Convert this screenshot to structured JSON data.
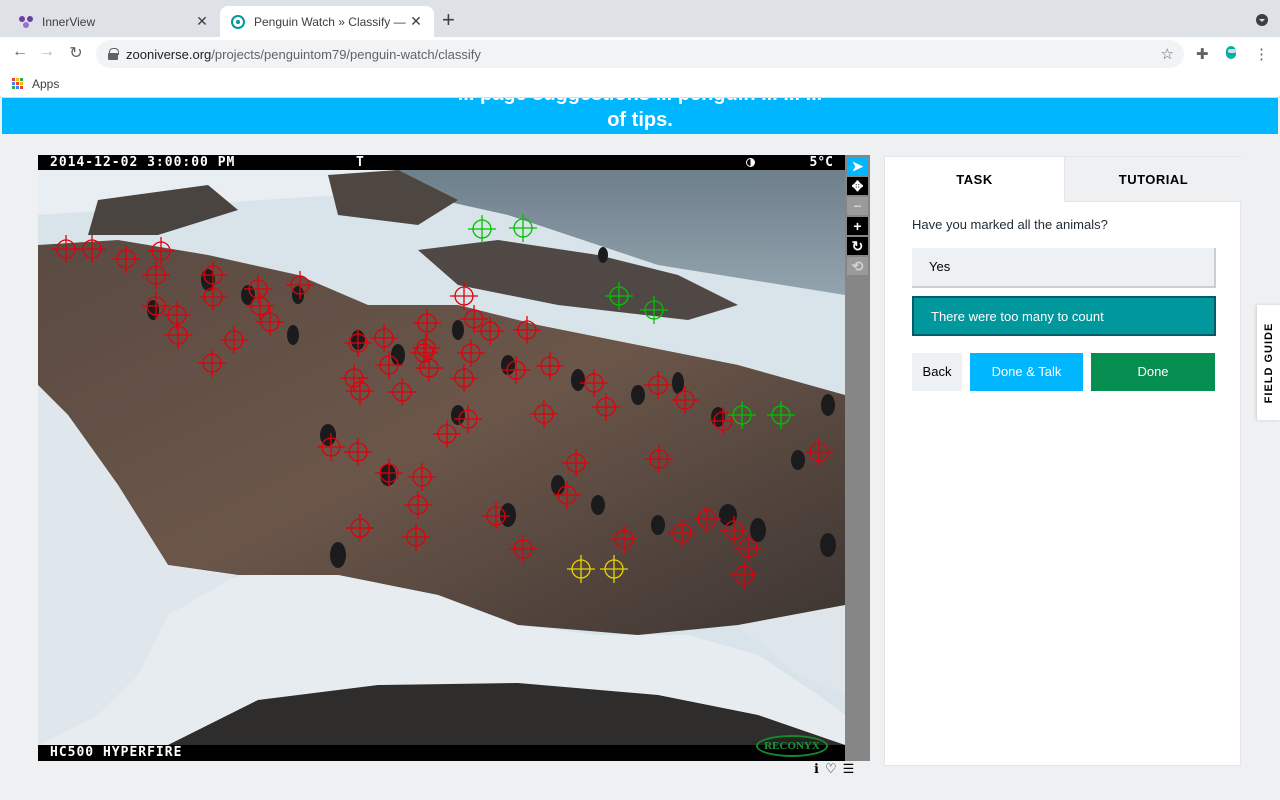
{
  "browser": {
    "tabs": [
      {
        "title": "InnerView",
        "active": false
      },
      {
        "title": "Penguin Watch » Classify — Zo",
        "active": true
      }
    ],
    "new_tab_label": "+",
    "url_host": "zooniverse.org",
    "url_path": "/projects/penguintom79/penguin-watch/classify",
    "bookmarks": [
      {
        "label": "Apps"
      }
    ]
  },
  "banner": {
    "partial_text": "... page suggestions ... penguin ... ... ...",
    "tips_text": "of tips."
  },
  "camera": {
    "timestamp": "2014-12-02  3:00:00 PM",
    "flag": "T",
    "temperature": "5°C",
    "model": "HC500 HYPERFIRE",
    "brand": "RECONYX"
  },
  "tools": {
    "select": "➤",
    "pan": "✥",
    "zoom_out": "−",
    "zoom_in": "+",
    "rotate": "↻",
    "reset": "⟲"
  },
  "meta_icons": {
    "info": "ℹ",
    "favorite": "♡",
    "collections": "☰"
  },
  "panel": {
    "tabs": [
      {
        "label": "TASK"
      },
      {
        "label": "TUTORIAL"
      }
    ],
    "question": "Have you marked all the animals?",
    "answers": [
      {
        "label": "Yes",
        "selected": false
      },
      {
        "label": "There were too many to count",
        "selected": true
      }
    ],
    "buttons": {
      "back": "Back",
      "done_talk": "Done & Talk",
      "done": "Done"
    }
  },
  "field_guide_label": "FIELD GUIDE",
  "colors": {
    "accent": "#00b6ff",
    "selected_answer": "#00979d",
    "done": "#078f52",
    "marker_adult": "#e0000b",
    "marker_chick": "#00c200",
    "marker_egg": "#e6d400"
  }
}
